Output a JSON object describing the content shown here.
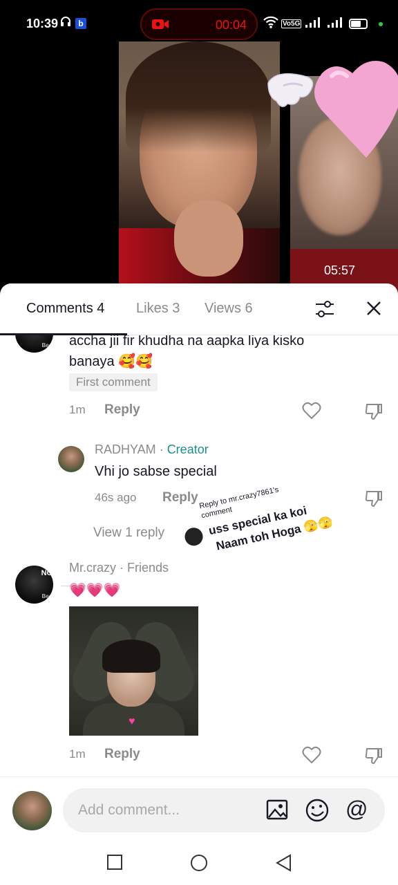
{
  "status_bar": {
    "time": "10:39",
    "b_badge": "b",
    "record_timer": "00:04",
    "volte_label": "Vo5G",
    "icons": [
      "headphone-icon",
      "camera-record-icon",
      "wifi-icon",
      "signal-icon",
      "battery-icon"
    ]
  },
  "video": {
    "pip_timer": "05:57"
  },
  "tabs": {
    "comments": "Comments 4",
    "likes": "Likes 3",
    "views": "Views 6"
  },
  "comments": {
    "first": {
      "text_line1": "accha jii fir khudha na aapka liya kisko",
      "text_line2": "banaya 🥰🥰",
      "badge": "First comment",
      "time": "1m",
      "reply_label": "Reply"
    },
    "reply": {
      "author": "RADHYAM",
      "separator": " · ",
      "creator_label": "Creator",
      "text": "Vhi jo sabse special",
      "time": "46s ago",
      "reply_label": "Reply"
    },
    "view_replies": "View 1 reply",
    "sticker_overlay": {
      "line_small1": "Reply to mr.crazy7861's",
      "line_small2": "comment",
      "line_big1": "uss special ka koi",
      "line_big2": "Naam toh Hoga 🫣🫣"
    },
    "second": {
      "author": "Mr.crazy · Friends",
      "text": "💗💗💗",
      "time": "1m",
      "reply_label": "Reply"
    },
    "avatar_text": {
      "top": "NO DP",
      "bottom": "Because"
    }
  },
  "comment_bar": {
    "placeholder": "Add comment...",
    "mention": "@"
  },
  "colors": {
    "accent_creator": "#1e8e8a",
    "record_red": "#ee1111",
    "text_primary": "#161823",
    "text_secondary": "#8a8a8a"
  }
}
